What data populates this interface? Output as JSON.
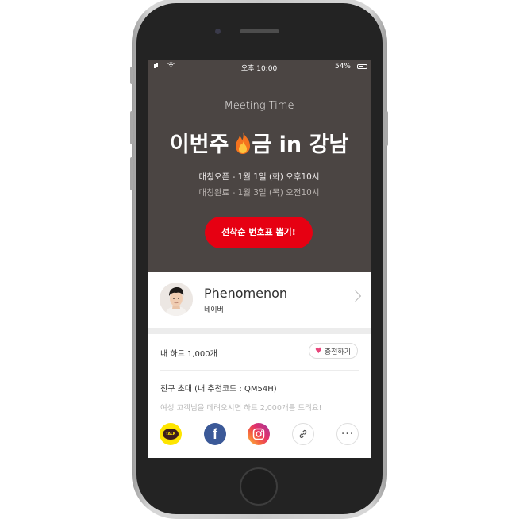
{
  "status_bar": {
    "time": "오후 10:00",
    "battery": "54%"
  },
  "hero": {
    "subtitle": "Meeting Time",
    "title_before": "이번주",
    "title_after": "금 in 강남",
    "open_time": "매칭오픈 - 1월 1일 (화) 오후10시",
    "close_time": "매칭완료 - 1월 3일 (목) 오전10시",
    "cta_label": "선착순 번호표 뽑기!"
  },
  "profile": {
    "name": "Phenomenon",
    "company": "네이버"
  },
  "hearts": {
    "label": "내 하트 1,000개",
    "charge_label": "충전하기"
  },
  "invite": {
    "title": "친구 초대 (내 추천코드 : QM54H)",
    "promo": "여성 고객님을 데려오시면 하트 2,000개를 드려요!"
  },
  "share": {
    "kakao_text": "TALK",
    "facebook_glyph": "f",
    "more_glyph": "···"
  },
  "colors": {
    "hero_bg": "#4b4543",
    "cta": "#e60012",
    "heart": "#e8467b",
    "kakao": "#fee500",
    "facebook": "#3b5998"
  }
}
